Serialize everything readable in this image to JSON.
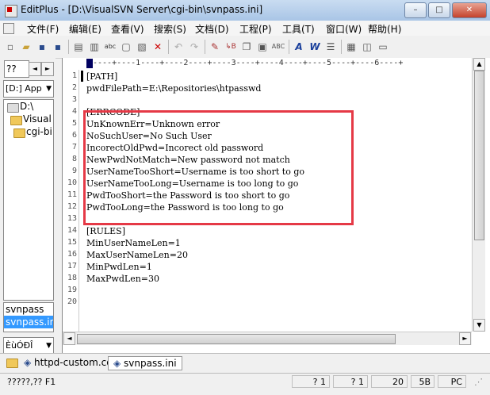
{
  "window": {
    "title": "EditPlus - [D:\\VisualSVN Server\\cgi-bin\\svnpass.ini]",
    "min_glyph": "–",
    "max_glyph": "□",
    "close_glyph": "✕"
  },
  "menu": [
    {
      "label": "文件(F)"
    },
    {
      "label": "编辑(E)"
    },
    {
      "label": "查看(V)"
    },
    {
      "label": "搜索(S)"
    },
    {
      "label": "文档(D)"
    },
    {
      "label": "工程(P)"
    },
    {
      "label": "工具(T)"
    },
    {
      "label": "窗口(W)"
    },
    {
      "label": "帮助(H)"
    }
  ],
  "toolbar_icons": [
    "new-file-icon",
    "open-folder-icon",
    "save-icon",
    "save-all-icon",
    "print-preview-icon",
    "print-icon",
    "spellcheck-icon",
    "find-icon",
    "find-replace-icon",
    "delete-icon",
    "undo-icon",
    "redo-icon",
    "pen-icon",
    "replace-icon",
    "copy-icon",
    "paste-icon",
    "font-icon",
    "wordwrap-icon",
    "line-number-icon",
    "column-icon",
    "ruler-icon"
  ],
  "left_panel": {
    "tab_label": "??",
    "drive": "[D:] App",
    "tree": [
      {
        "label": "D:\\",
        "icon": "drive-icon"
      },
      {
        "label": "Visual",
        "icon": "folder-open-icon"
      },
      {
        "label": "cgi-bi",
        "icon": "folder-open-icon"
      }
    ],
    "files": [
      {
        "label": "svnpass",
        "selected": false
      },
      {
        "label": "svnpass.ini",
        "selected": true
      }
    ],
    "encoding": "ÈùÓÐÎ"
  },
  "editor": {
    "ruler_text": "----+----1----+----2----+----3----+----4----+----5----+----6----+",
    "lines": [
      {
        "n": "1",
        "text": "[PATH]"
      },
      {
        "n": "2",
        "text": "pwdFilePath=E:\\Repositories\\htpasswd"
      },
      {
        "n": "3",
        "text": ""
      },
      {
        "n": "4",
        "text": "[ERRCODE]"
      },
      {
        "n": "5",
        "text": "UnKnownErr=Unknown error"
      },
      {
        "n": "6",
        "text": "NoSuchUser=No Such User"
      },
      {
        "n": "7",
        "text": "IncorectOldPwd=Incorect old password"
      },
      {
        "n": "8",
        "text": "NewPwdNotMatch=New password not match"
      },
      {
        "n": "9",
        "text": "UserNameTooShort=Username is too short to go"
      },
      {
        "n": "10",
        "text": "UserNameTooLong=Username is too long to go"
      },
      {
        "n": "11",
        "text": "PwdTooShort=the Password is too short to go"
      },
      {
        "n": "12",
        "text": "PwdTooLong=the Password is too long to go"
      },
      {
        "n": "13",
        "text": ""
      },
      {
        "n": "14",
        "text": "[RULES]"
      },
      {
        "n": "15",
        "text": "MinUserNameLen=1"
      },
      {
        "n": "16",
        "text": "MaxUserNameLen=20"
      },
      {
        "n": "17",
        "text": "MinPwdLen=1"
      },
      {
        "n": "18",
        "text": "MaxPwdLen=30"
      },
      {
        "n": "19",
        "text": ""
      },
      {
        "n": "20",
        "text": ""
      }
    ],
    "highlight_color": "#e53946"
  },
  "doc_tabs": [
    {
      "label": "httpd-custom.co",
      "active": false
    },
    {
      "label": "svnpass.ini",
      "active": true
    }
  ],
  "status": {
    "message": "?????,?? F1",
    "line": "? 1",
    "col": "? 1",
    "total": "20",
    "size": "5B",
    "format": "PC"
  }
}
